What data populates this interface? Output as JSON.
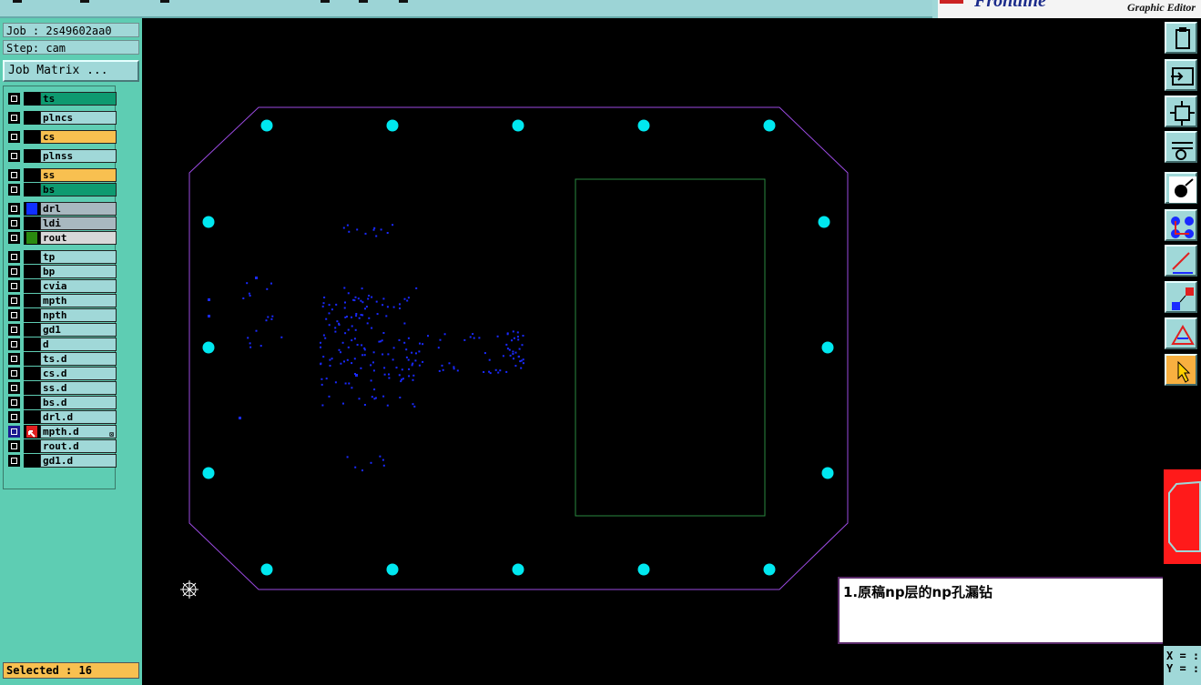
{
  "brand": {
    "subtitle": "Graphic Editor",
    "logo_text": "Frontline"
  },
  "job": {
    "job_label": "Job : 2s49602aa0",
    "step_label": "Step: cam",
    "job_matrix_button": "Job Matrix ..."
  },
  "layers": [
    {
      "name": "ts",
      "bg": "#0e9a70",
      "swatch": "#000000",
      "group_gap": false
    },
    {
      "name": "plncs",
      "bg": "#a0d8d8",
      "swatch": "#000000"
    },
    {
      "name": "cs",
      "bg": "#f8c050",
      "swatch": "#000000"
    },
    {
      "name": "plnss",
      "bg": "#a0d8d8",
      "swatch": "#000000"
    },
    {
      "name": "ss",
      "bg": "#f8c050",
      "swatch": "#000000"
    },
    {
      "name": "bs",
      "bg": "#0e9a70",
      "swatch": "#000000"
    },
    {
      "name": "drl",
      "bg": "#a8b8c0",
      "swatch": "#1030ff"
    },
    {
      "name": "ldi",
      "bg": "#a8b8c0",
      "swatch": "#000000"
    },
    {
      "name": "rout",
      "bg": "#d8d8d8",
      "swatch": "#2a8a10"
    },
    {
      "name": "tp",
      "bg": "#a0d8d8",
      "swatch": "#000000"
    },
    {
      "name": "bp",
      "bg": "#a0d8d8",
      "swatch": "#000000"
    },
    {
      "name": "cvia",
      "bg": "#a0d8d8",
      "swatch": "#000000"
    },
    {
      "name": "mpth",
      "bg": "#a0d8d8",
      "swatch": "#000000"
    },
    {
      "name": "npth",
      "bg": "#a0d8d8",
      "swatch": "#000000"
    },
    {
      "name": "gd1",
      "bg": "#a0d8d8",
      "swatch": "#000000"
    },
    {
      "name": "d",
      "bg": "#a0d8d8",
      "swatch": "#000000"
    },
    {
      "name": "ts.d",
      "bg": "#a0d8d8",
      "swatch": "#000000"
    },
    {
      "name": "cs.d",
      "bg": "#a0d8d8",
      "swatch": "#000000"
    },
    {
      "name": "ss.d",
      "bg": "#a0d8d8",
      "swatch": "#000000"
    },
    {
      "name": "bs.d",
      "bg": "#a0d8d8",
      "swatch": "#000000"
    },
    {
      "name": "drl.d",
      "bg": "#a0d8d8",
      "swatch": "#000000"
    },
    {
      "name": "mpth.d",
      "bg": "#a0d8d8",
      "swatch": "#e02020",
      "affected": true,
      "affected_mark": "⊠"
    },
    {
      "name": "rout.d",
      "bg": "#a0d8d8",
      "swatch": "#000000"
    },
    {
      "name": "gd1.d",
      "bg": "#a0d8d8",
      "swatch": "#000000"
    }
  ],
  "status": {
    "selected_label": "Selected : 16"
  },
  "annotation": {
    "note_text": "1.原稿np层的np孔漏钻"
  },
  "coords": {
    "x_label": "X = :",
    "y_label": "Y = :"
  },
  "toolbar": {
    "tools": [
      "clipboard-icon",
      "frame-in-icon",
      "zoom-fit-icon",
      "settings-pen-icon",
      "feature-select-icon",
      "connect-icon",
      "measure-icon",
      "transform-icon",
      "drc-icon",
      "pointer-icon"
    ]
  },
  "colors": {
    "canvas_bg": "#000000",
    "panel_bg": "#5ecdb3",
    "outline": "#9a4ae0",
    "rout": "#2a8a40",
    "tooling_holes": "#00e8f0",
    "drill": "#1a2aff"
  }
}
